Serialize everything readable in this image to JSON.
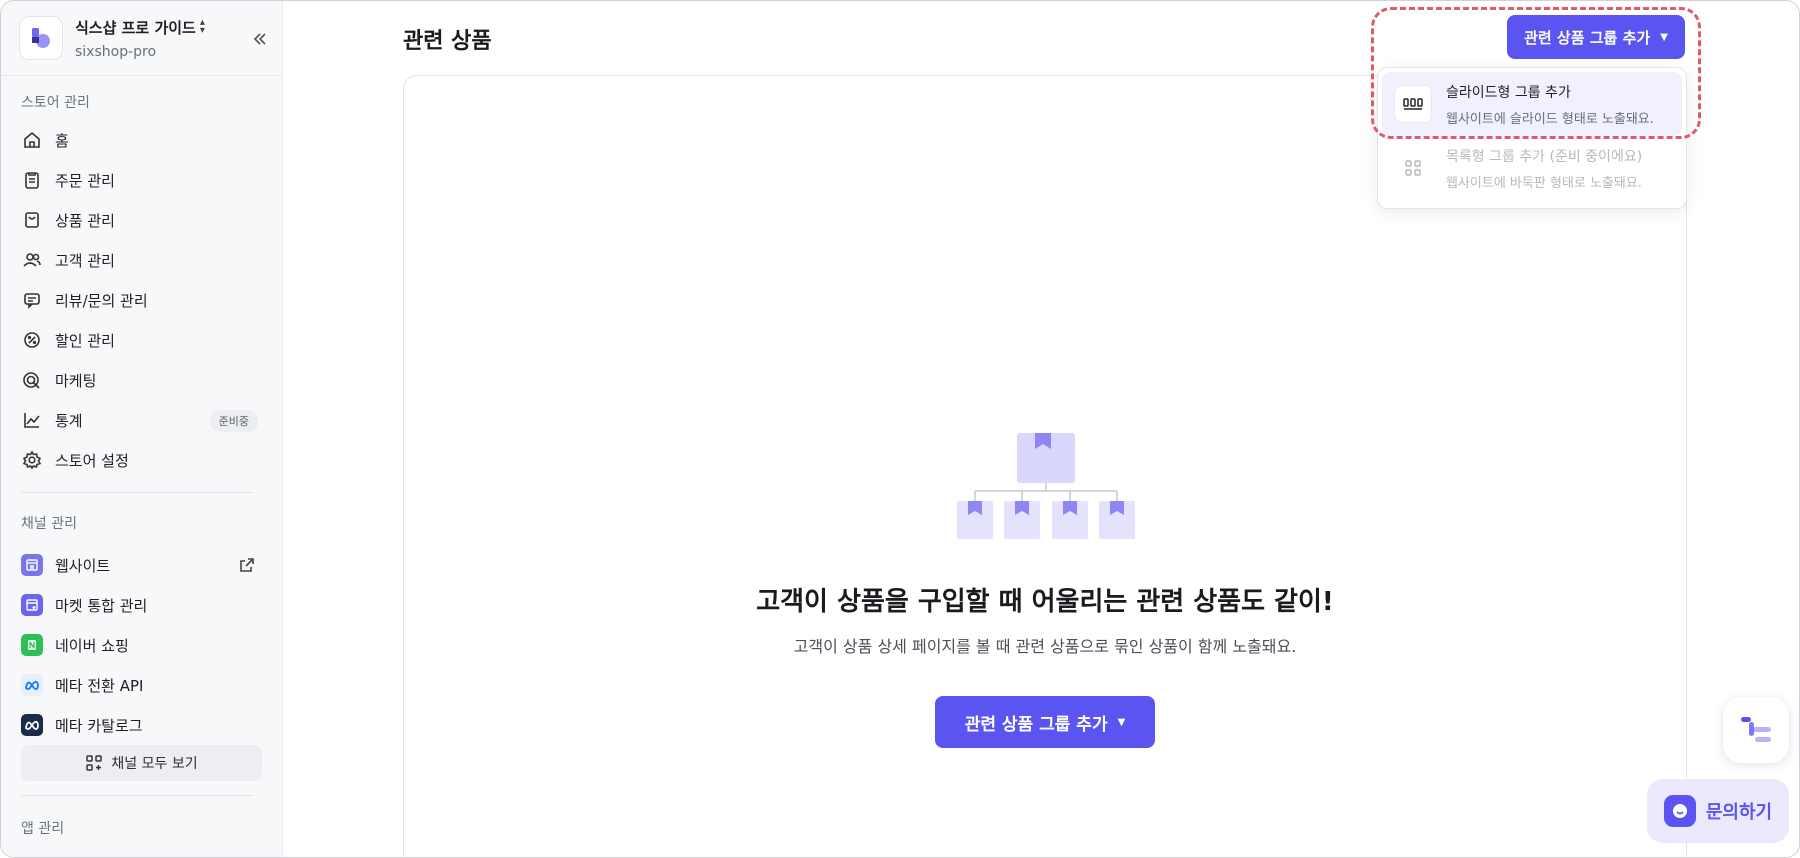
{
  "store": {
    "name": "식스샵 프로 가이드",
    "sub": "sixshop-pro"
  },
  "sidebar": {
    "store_section": "스토어 관리",
    "items": [
      {
        "label": "홈",
        "icon": "home-icon"
      },
      {
        "label": "주문 관리",
        "icon": "clipboard-icon"
      },
      {
        "label": "상품 관리",
        "icon": "shopping-bag-icon"
      },
      {
        "label": "고객 관리",
        "icon": "users-icon"
      },
      {
        "label": "리뷰/문의 관리",
        "icon": "message-icon"
      },
      {
        "label": "할인 관리",
        "icon": "percent-badge-icon"
      },
      {
        "label": "마케팅",
        "icon": "target-icon"
      },
      {
        "label": "통계",
        "icon": "chart-line-icon",
        "badge": "준비중"
      },
      {
        "label": "스토어 설정",
        "icon": "settings-icon"
      }
    ],
    "channel_section": "채널 관리",
    "channels": [
      {
        "label": "웹사이트",
        "icon": "website-icon",
        "color": "#7b74f0"
      },
      {
        "label": "마켓 통합 관리",
        "icon": "market-icon",
        "color": "#6a64ee"
      },
      {
        "label": "네이버 쇼핑",
        "icon": "naver-icon",
        "color": "#2fbf5a"
      },
      {
        "label": "메타 전환 API",
        "icon": "meta-icon",
        "color": "#e8eefc"
      },
      {
        "label": "메타 카탈로그",
        "icon": "meta-catalog-icon",
        "color": "#1c2b4a"
      }
    ],
    "all_channels": "채널 모두 보기",
    "app_section": "앱 관리"
  },
  "main": {
    "title": "관련 상품",
    "add_group_button": "관련 상품 그룹 추가",
    "empty_title": "고객이 상품을 구입할 때 어울리는 관련 상품도 같이!",
    "empty_desc": "고객이 상품 상세 페이지를 볼 때 관련 상품으로 묶인 상품이 함께 노출돼요.",
    "center_button": "관련 상품 그룹 추가"
  },
  "dropdown": {
    "items": [
      {
        "title": "슬라이드형 그룹 추가",
        "desc": "웹사이트에 슬라이드 형태로 노출돼요.",
        "icon": "slide-group-icon",
        "disabled": false
      },
      {
        "title": "목록형 그룹 추가 (준비 중이에요)",
        "desc": "웹사이트에 바둑판 형태로 노출돼요.",
        "icon": "grid-group-icon",
        "disabled": true
      }
    ]
  },
  "floating": {
    "chat_label": "문의하기"
  },
  "colors": {
    "accent": "#5a54f0",
    "highlight": "#df5a6e"
  }
}
